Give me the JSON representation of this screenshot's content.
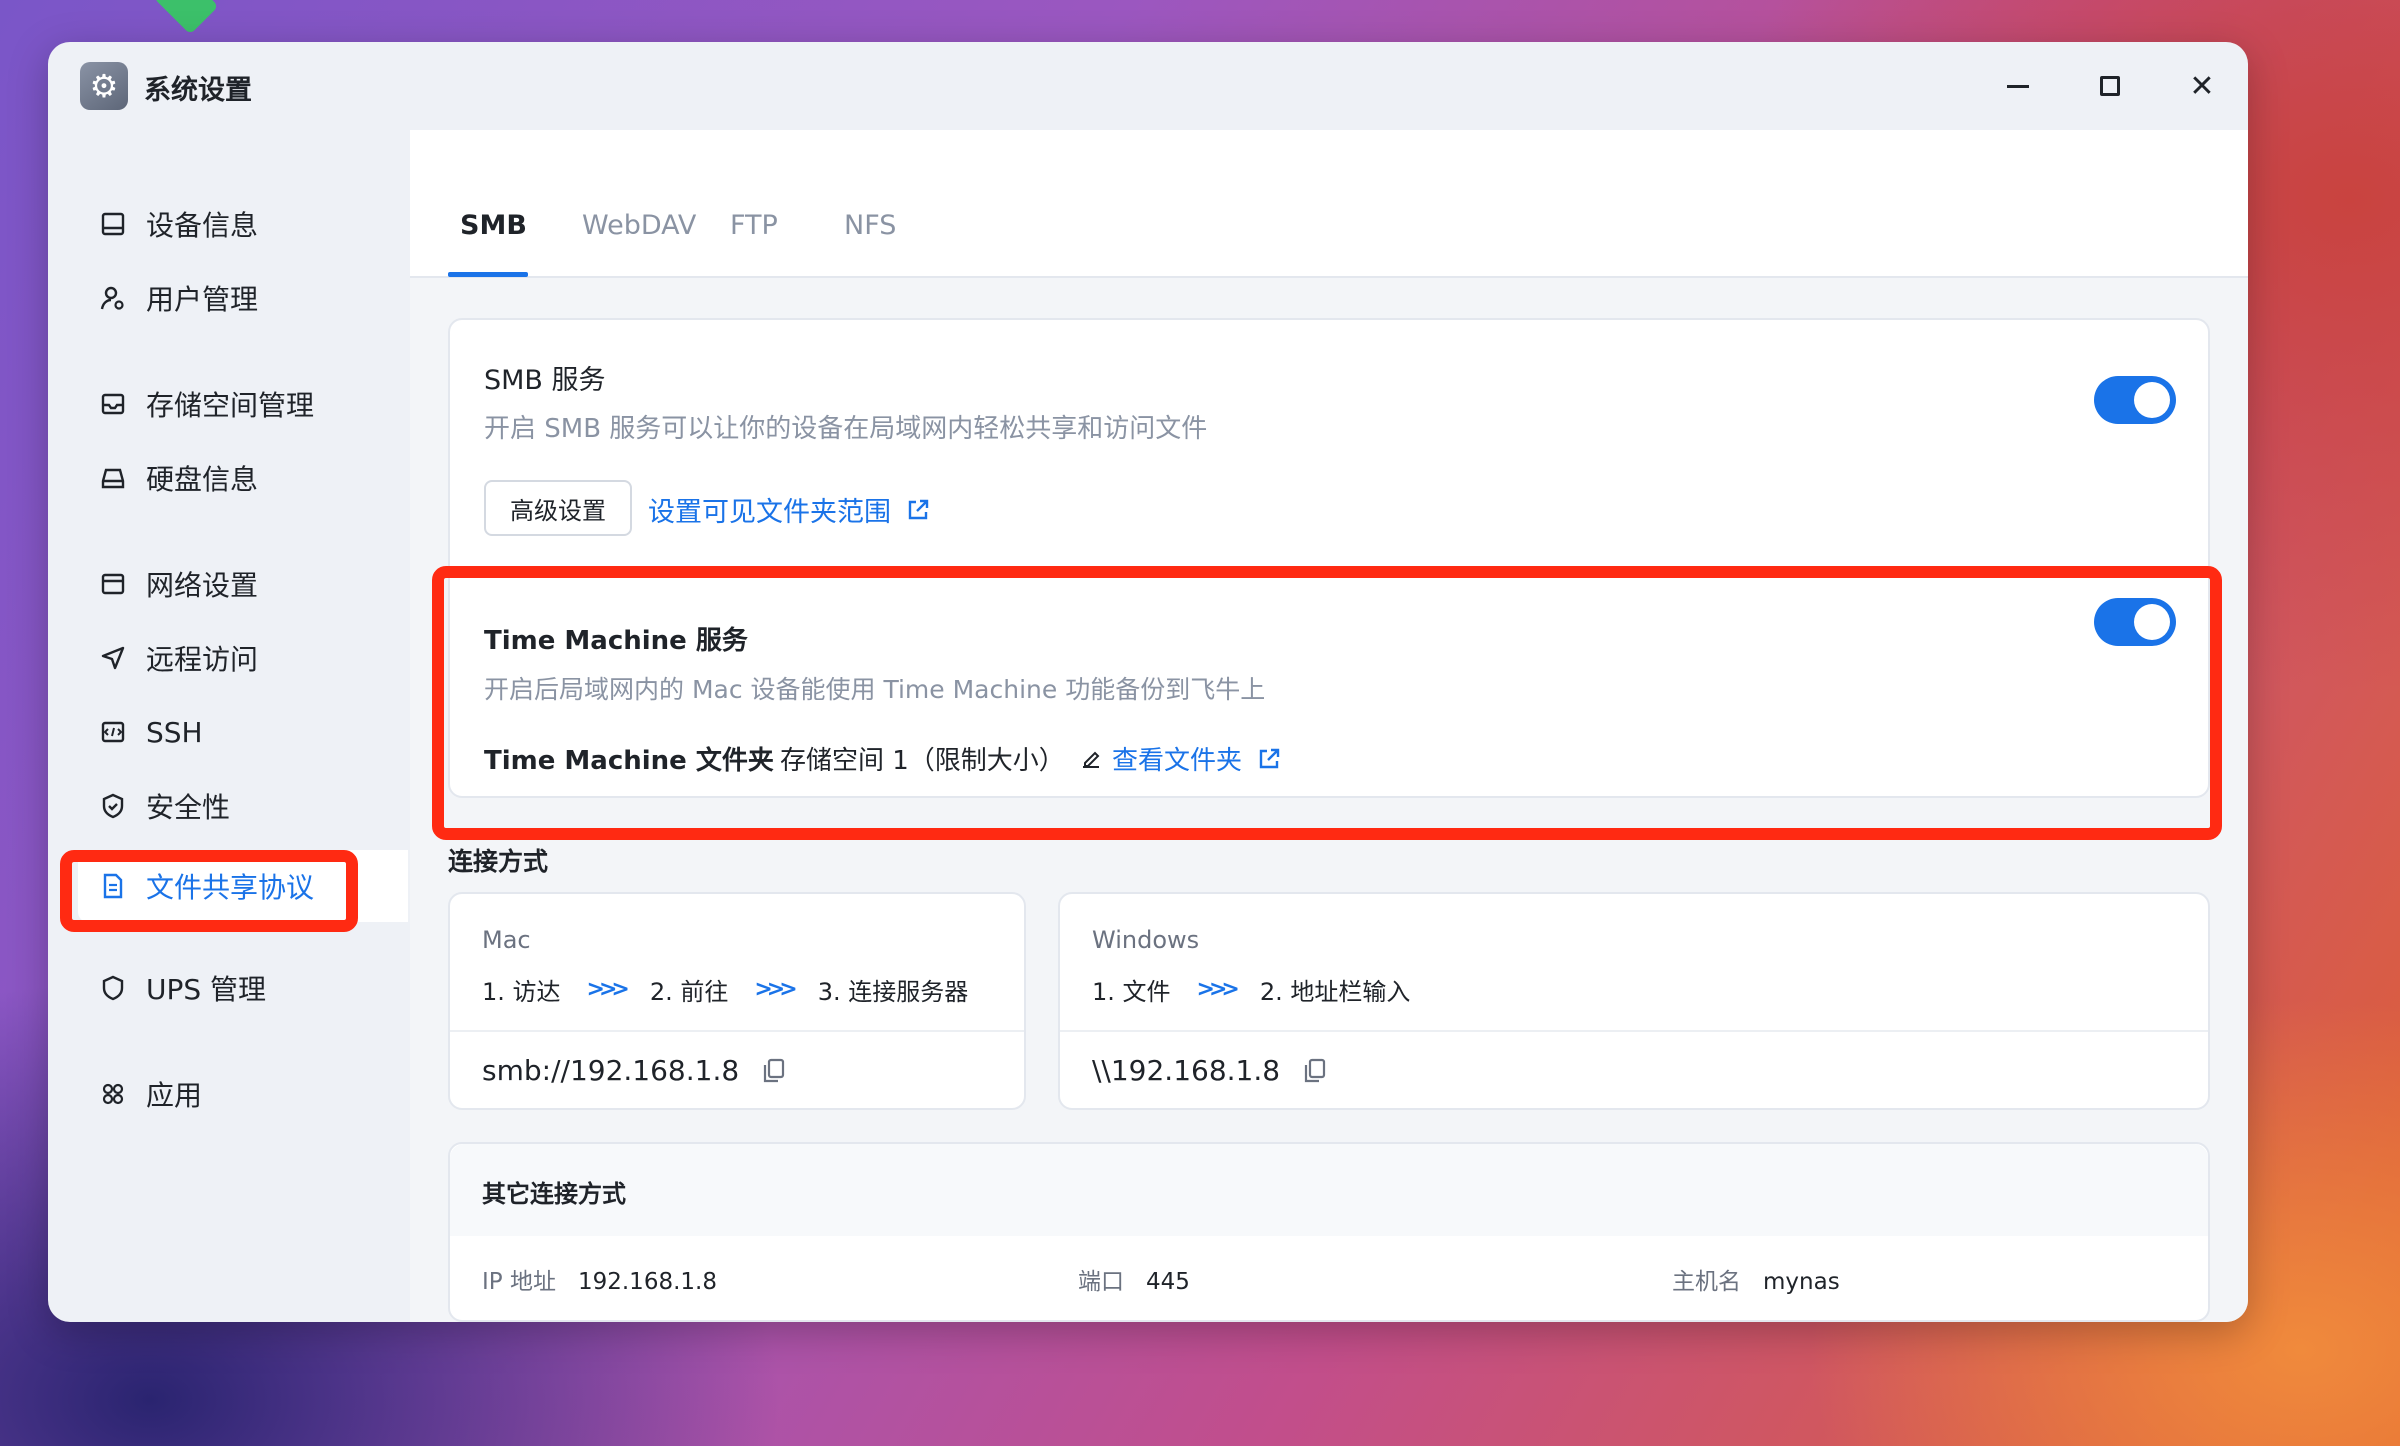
{
  "window": {
    "title": "系统设置"
  },
  "sidebar": {
    "items": [
      {
        "label": "设备信息",
        "icon": "device-icon"
      },
      {
        "label": "用户管理",
        "icon": "user-gear-icon"
      },
      {
        "label": "存储空间管理",
        "icon": "storage-icon"
      },
      {
        "label": "硬盘信息",
        "icon": "disk-icon"
      },
      {
        "label": "网络设置",
        "icon": "network-icon"
      },
      {
        "label": "远程访问",
        "icon": "send-icon"
      },
      {
        "label": "SSH",
        "icon": "terminal-icon"
      },
      {
        "label": "安全性",
        "icon": "shield-check-icon"
      },
      {
        "label": "文件共享协议",
        "icon": "file-share-icon",
        "active": true
      },
      {
        "label": "UPS 管理",
        "icon": "shield-icon"
      },
      {
        "label": "应用",
        "icon": "apps-icon"
      }
    ]
  },
  "tabs": [
    {
      "label": "SMB",
      "active": true
    },
    {
      "label": "WebDAV"
    },
    {
      "label": "FTP"
    },
    {
      "label": "NFS"
    }
  ],
  "smb": {
    "title": "SMB 服务",
    "description": "开启 SMB 服务可以让你的设备在局域网内轻松共享和访问文件",
    "enabled": true,
    "advanced_button": "高级设置",
    "folder_scope_link": "设置可见文件夹范围"
  },
  "time_machine": {
    "title": "Time Machine 服务",
    "description": "开启后局域网内的 Mac 设备能使用 Time Machine 功能备份到飞牛上",
    "enabled": true,
    "folder_label": "Time Machine 文件夹",
    "folder_value": "存储空间 1（限制大小）",
    "view_folder_link": "查看文件夹"
  },
  "connection": {
    "section_title": "连接方式",
    "mac": {
      "title": "Mac",
      "steps": [
        "1. 访达",
        "2. 前往",
        "3. 连接服务器"
      ],
      "address": "smb://192.168.1.8"
    },
    "windows": {
      "title": "Windows",
      "steps": [
        "1. 文件",
        "2. 地址栏输入"
      ],
      "address": "\\\\192.168.1.8"
    }
  },
  "other": {
    "title": "其它连接方式",
    "ip_label": "IP 地址",
    "ip_value": "192.168.1.8",
    "port_label": "端口",
    "port_value": "445",
    "host_label": "主机名",
    "host_value": "mynas"
  },
  "colors": {
    "accent": "#1a73e8",
    "highlight": "#ff2a12"
  }
}
